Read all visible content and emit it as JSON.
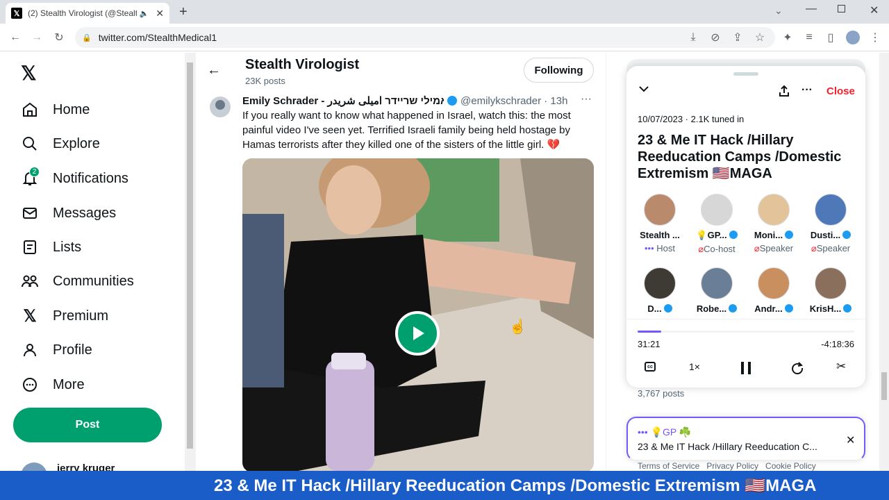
{
  "browser": {
    "tab_title": "(2) Stealth Virologist (@Stealth",
    "url": "twitter.com/StealthMedical1"
  },
  "nav": {
    "items": [
      {
        "label": "Home",
        "icon": "home-icon"
      },
      {
        "label": "Explore",
        "icon": "search-icon"
      },
      {
        "label": "Notifications",
        "icon": "bell-icon",
        "badge": "2"
      },
      {
        "label": "Messages",
        "icon": "mail-icon"
      },
      {
        "label": "Lists",
        "icon": "list-icon"
      },
      {
        "label": "Communities",
        "icon": "people-icon"
      },
      {
        "label": "Premium",
        "icon": "x-logo-icon"
      },
      {
        "label": "Profile",
        "icon": "person-icon"
      },
      {
        "label": "More",
        "icon": "more-circle-icon"
      }
    ],
    "post_label": "Post",
    "account_name": "jerry kruger"
  },
  "header": {
    "name": "Stealth Virologist",
    "post_count": "23K posts",
    "follow_label": "Following"
  },
  "tweet": {
    "author_name": "Emily Schrader - אמילי שריידר امیلی شریدر",
    "handle_time": "@emilykschrader · 13h",
    "text": "If you really want to know what happened in Israel, watch this: the most painful video I've seen yet. Terrified Israeli family being held hostage by Hamas terrorists after they killed one of the sisters of the little girl. 💔"
  },
  "space": {
    "close_label": "Close",
    "meta": "10/07/2023 · 2.1K tuned in",
    "title": "23 & Me IT Hack /Hillary Reeducation Camps /Domestic Extremism 🇺🇸MAGA",
    "participants": [
      {
        "name": "Stealth ...",
        "role": "Host",
        "verified": false
      },
      {
        "name": "💡GP...",
        "role": "Co-host",
        "verified": true
      },
      {
        "name": "Moni...",
        "role": "Speaker",
        "verified": true
      },
      {
        "name": "Dusti...",
        "role": "Speaker",
        "verified": true
      },
      {
        "name": "D...",
        "role": "",
        "verified": true
      },
      {
        "name": "Robe...",
        "role": "",
        "verified": true
      },
      {
        "name": "Andr...",
        "role": "",
        "verified": true
      },
      {
        "name": "KrisH...",
        "role": "",
        "verified": true
      }
    ],
    "elapsed": "31:21",
    "remaining": "-4:18:36",
    "progress": 0.11,
    "speed": "1×",
    "posts_count": "3,767 posts",
    "mini_host": "💡GP ☘️",
    "mini_title": "23 & Me IT Hack /Hillary Reeducation C..."
  },
  "footer_links": "Terms of Service   Privacy Policy   Cookie Policy",
  "banner_text": "23 & Me IT Hack /Hillary Reeducation Camps /Domestic Extremism 🇺🇸MAGA",
  "colors": {
    "accent": "#1d9bf0",
    "post_button": "#00a06e",
    "banner": "#1a5cc8",
    "close": "#f4212e"
  }
}
